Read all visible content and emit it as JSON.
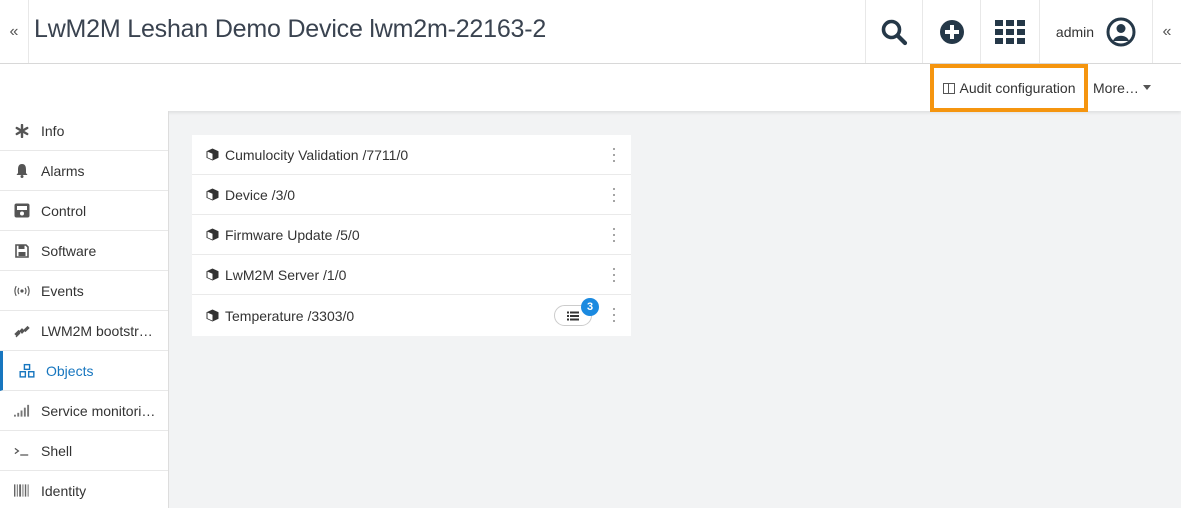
{
  "header": {
    "title": "LwM2M Leshan Demo Device lwm2m-22163-2",
    "user": "admin",
    "collapse_left": "«",
    "collapse_right": "«",
    "icons": [
      "search-icon",
      "plus-circle-icon",
      "app-grid-icon",
      "user-circle-icon"
    ]
  },
  "actions": {
    "audit_label": "Audit configuration",
    "more_label": "More…",
    "highlight_color": "#f5950f"
  },
  "sidebar": {
    "active_color": "#1776bf",
    "items": [
      {
        "label": "Info",
        "icon": "asterisk-icon"
      },
      {
        "label": "Alarms",
        "icon": "bell-icon"
      },
      {
        "label": "Control",
        "icon": "control-panel-icon"
      },
      {
        "label": "Software",
        "icon": "floppy-disk-icon"
      },
      {
        "label": "Events",
        "icon": "broadcast-icon"
      },
      {
        "label": "LWM2M bootstr…",
        "icon": "satellite-icon"
      },
      {
        "label": "Objects",
        "icon": "cubes-icon",
        "active": true
      },
      {
        "label": "Service monitori…",
        "icon": "signal-bars-icon"
      },
      {
        "label": "Shell",
        "icon": "terminal-icon"
      },
      {
        "label": "Identity",
        "icon": "barcode-icon"
      }
    ]
  },
  "objects": [
    {
      "label": "Cumulocity Validation /7711/0"
    },
    {
      "label": "Device /3/0"
    },
    {
      "label": "Firmware Update /5/0"
    },
    {
      "label": "LwM2M Server /1/0"
    },
    {
      "label": "Temperature /3303/0",
      "badge": "3"
    }
  ]
}
